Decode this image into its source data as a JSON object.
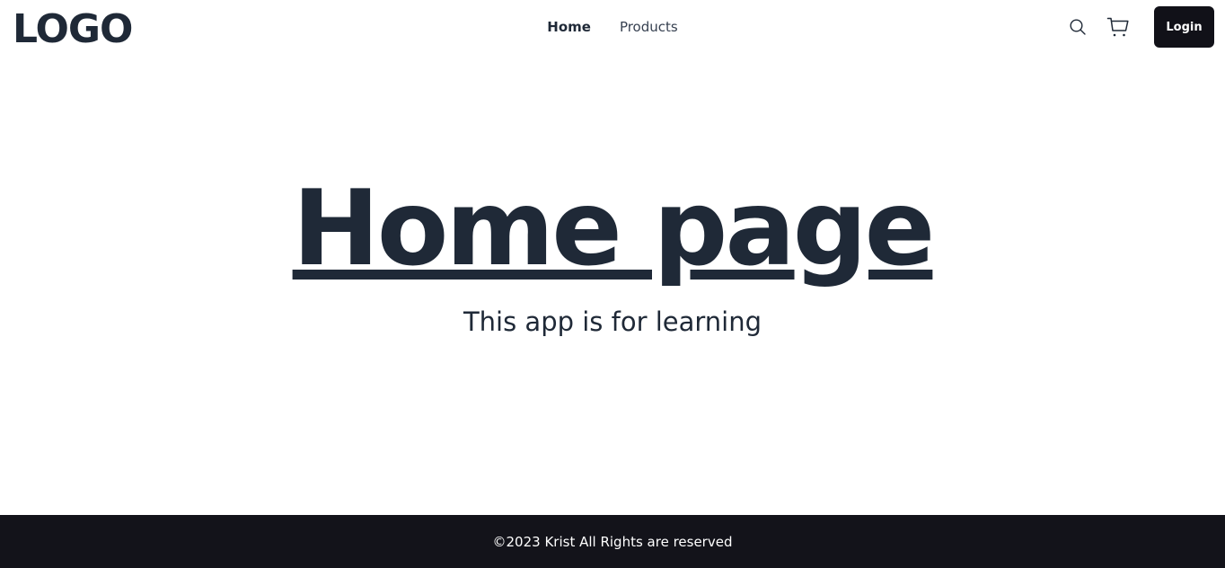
{
  "header": {
    "logo_text": "LOGO",
    "nav": {
      "home_label": "Home",
      "products_label": "Products"
    },
    "search_icon": "search-icon",
    "cart_icon": "cart-icon",
    "login_label": "Login"
  },
  "hero": {
    "title": "Home page",
    "subtitle": "This app is for learning"
  },
  "footer": {
    "copyright": "©2023 Krist All Rights are reserved"
  },
  "colors": {
    "text": "#1f2937",
    "footer_bg": "#13131a",
    "login_bg": "#111118"
  }
}
